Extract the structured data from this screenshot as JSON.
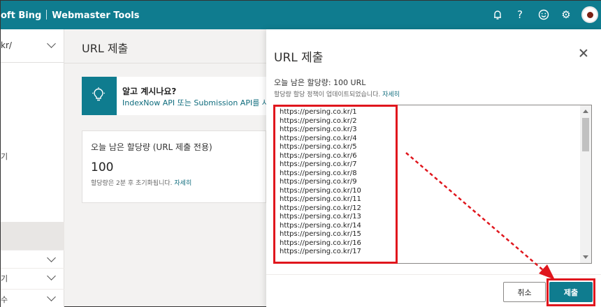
{
  "topbar": {
    "brand_partial": "oft Bing",
    "product": "Webmaster Tools",
    "icons": [
      "bell-icon",
      "help-icon",
      "smiley-icon",
      "gear-icon",
      "avatar"
    ]
  },
  "sidebar": {
    "site_partial": "kr/",
    "fragment_1": "기",
    "fragment_2": "기",
    "fragment_3": "수"
  },
  "main": {
    "page_title": "URL 제출",
    "banner": {
      "title": "알고 계시나요?",
      "text": "IndexNow API 또는 Submission API를 사용합"
    },
    "quota_card": {
      "label": "오늘 남은 할당량 (URL 제출 전용)",
      "value": "100",
      "note": "할당량은 2분 후 초기화됩니다.",
      "link": "자세히"
    }
  },
  "dialog": {
    "title": "URL 제출",
    "quota_line": "오늘 남은 할당량: 100 URL",
    "policy_line": "할당량 할당 정책이 업데이트되었습니다.",
    "policy_link": "자세히",
    "urls": [
      "https://persing.co.kr/1",
      "https://persing.co.kr/2",
      "https://persing.co.kr/3",
      "https://persing.co.kr/4",
      "https://persing.co.kr/5",
      "https://persing.co.kr/6",
      "https://persing.co.kr/7",
      "https://persing.co.kr/8",
      "https://persing.co.kr/9",
      "https://persing.co.kr/10",
      "https://persing.co.kr/11",
      "https://persing.co.kr/12",
      "https://persing.co.kr/13",
      "https://persing.co.kr/14",
      "https://persing.co.kr/15",
      "https://persing.co.kr/16",
      "https://persing.co.kr/17"
    ],
    "cancel_label": "취소",
    "submit_label": "제출"
  },
  "colors": {
    "brand_teal": "#0f7c8f",
    "annotation_red": "#e0161d"
  }
}
